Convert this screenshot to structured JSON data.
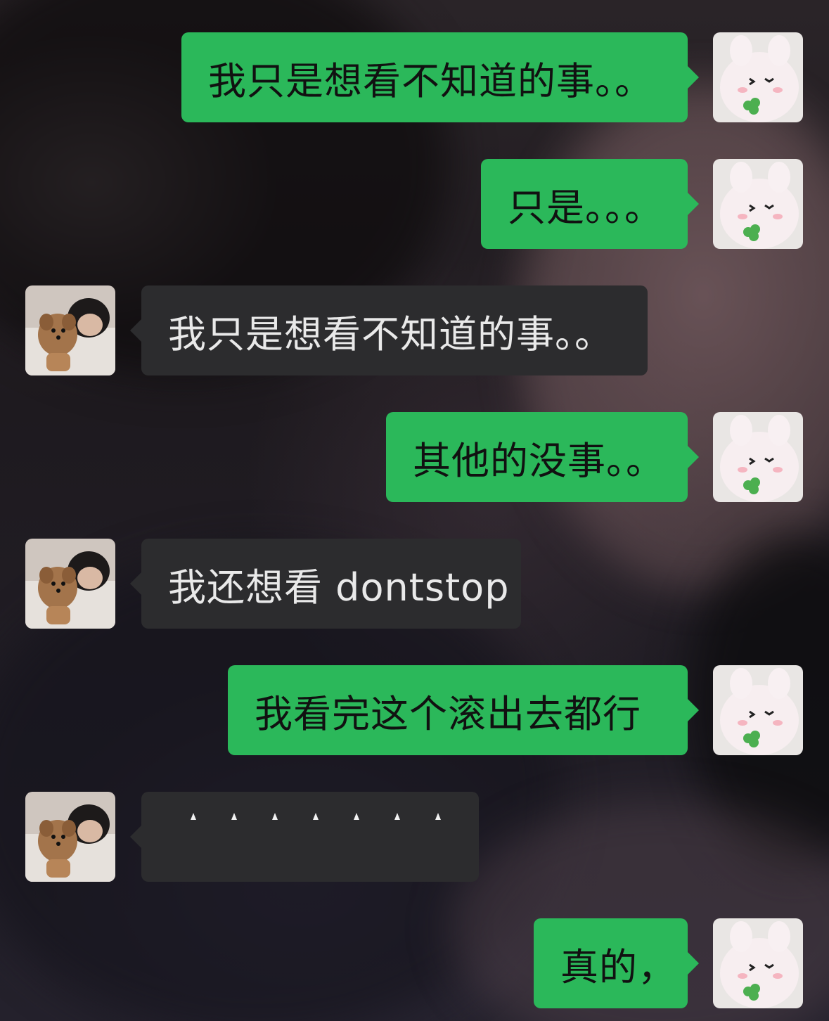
{
  "chat": {
    "messages": [
      {
        "side": "right",
        "text": "我只是想看不知道的事。。"
      },
      {
        "side": "right",
        "text": "只是。。。"
      },
      {
        "side": "left",
        "text": "我只是想看不知道的事。。"
      },
      {
        "side": "right",
        "text": "其他的没事。。"
      },
      {
        "side": "left",
        "text": "我还想看 dontstop"
      },
      {
        "side": "right",
        "text": "我看完这个滚出去都行"
      },
      {
        "side": "left",
        "text": ""
      },
      {
        "side": "right",
        "text": "真的，"
      }
    ]
  },
  "avatars": {
    "self": "bunny-plush-avatar",
    "other": "girl-with-dog-avatar"
  },
  "colors": {
    "mine_bubble": "#2bb85a",
    "theirs_bubble": "#2c2c2e",
    "mine_text": "#111111",
    "theirs_text": "#e9e9e9"
  }
}
